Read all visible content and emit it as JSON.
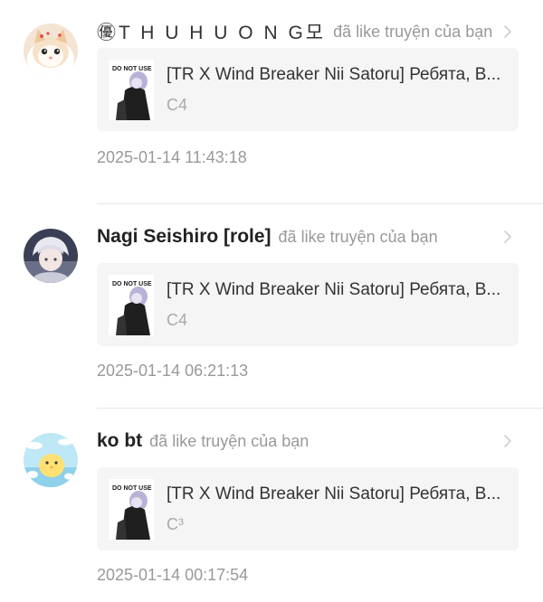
{
  "notifications": [
    {
      "username": "㊝T H U H U O N G모",
      "action": "đã like truyện của bạn",
      "story_title": "[TR X Wind Breaker Nii Satoru] Ребята, В...",
      "chapter": "C4",
      "timestamp": "2025-01-14 11:43:18",
      "avatar_icon": "cat-avatar-icon",
      "cover_text": "DO NOT USE"
    },
    {
      "username": "Nagi Seishiro [role]",
      "action": "đã like truyện của bạn",
      "story_title": "[TR X Wind Breaker Nii Satoru] Ребята, В...",
      "chapter": "C4",
      "timestamp": "2025-01-14 06:21:13",
      "avatar_icon": "anime-character-avatar-icon",
      "cover_text": "DO NOT USE"
    },
    {
      "username": "ko bt",
      "action": "đã like truyện của bạn",
      "story_title": "[TR X Wind Breaker Nii Satoru] Ребята, В...",
      "chapter": "C³",
      "timestamp": "2025-01-14 00:17:54",
      "avatar_icon": "chick-avatar-icon",
      "cover_text": "DO NOT USE"
    }
  ],
  "colors": {
    "username": "#222222",
    "action": "#999999",
    "card_background": "#f5f5f5",
    "divider": "#e6e6e6"
  }
}
